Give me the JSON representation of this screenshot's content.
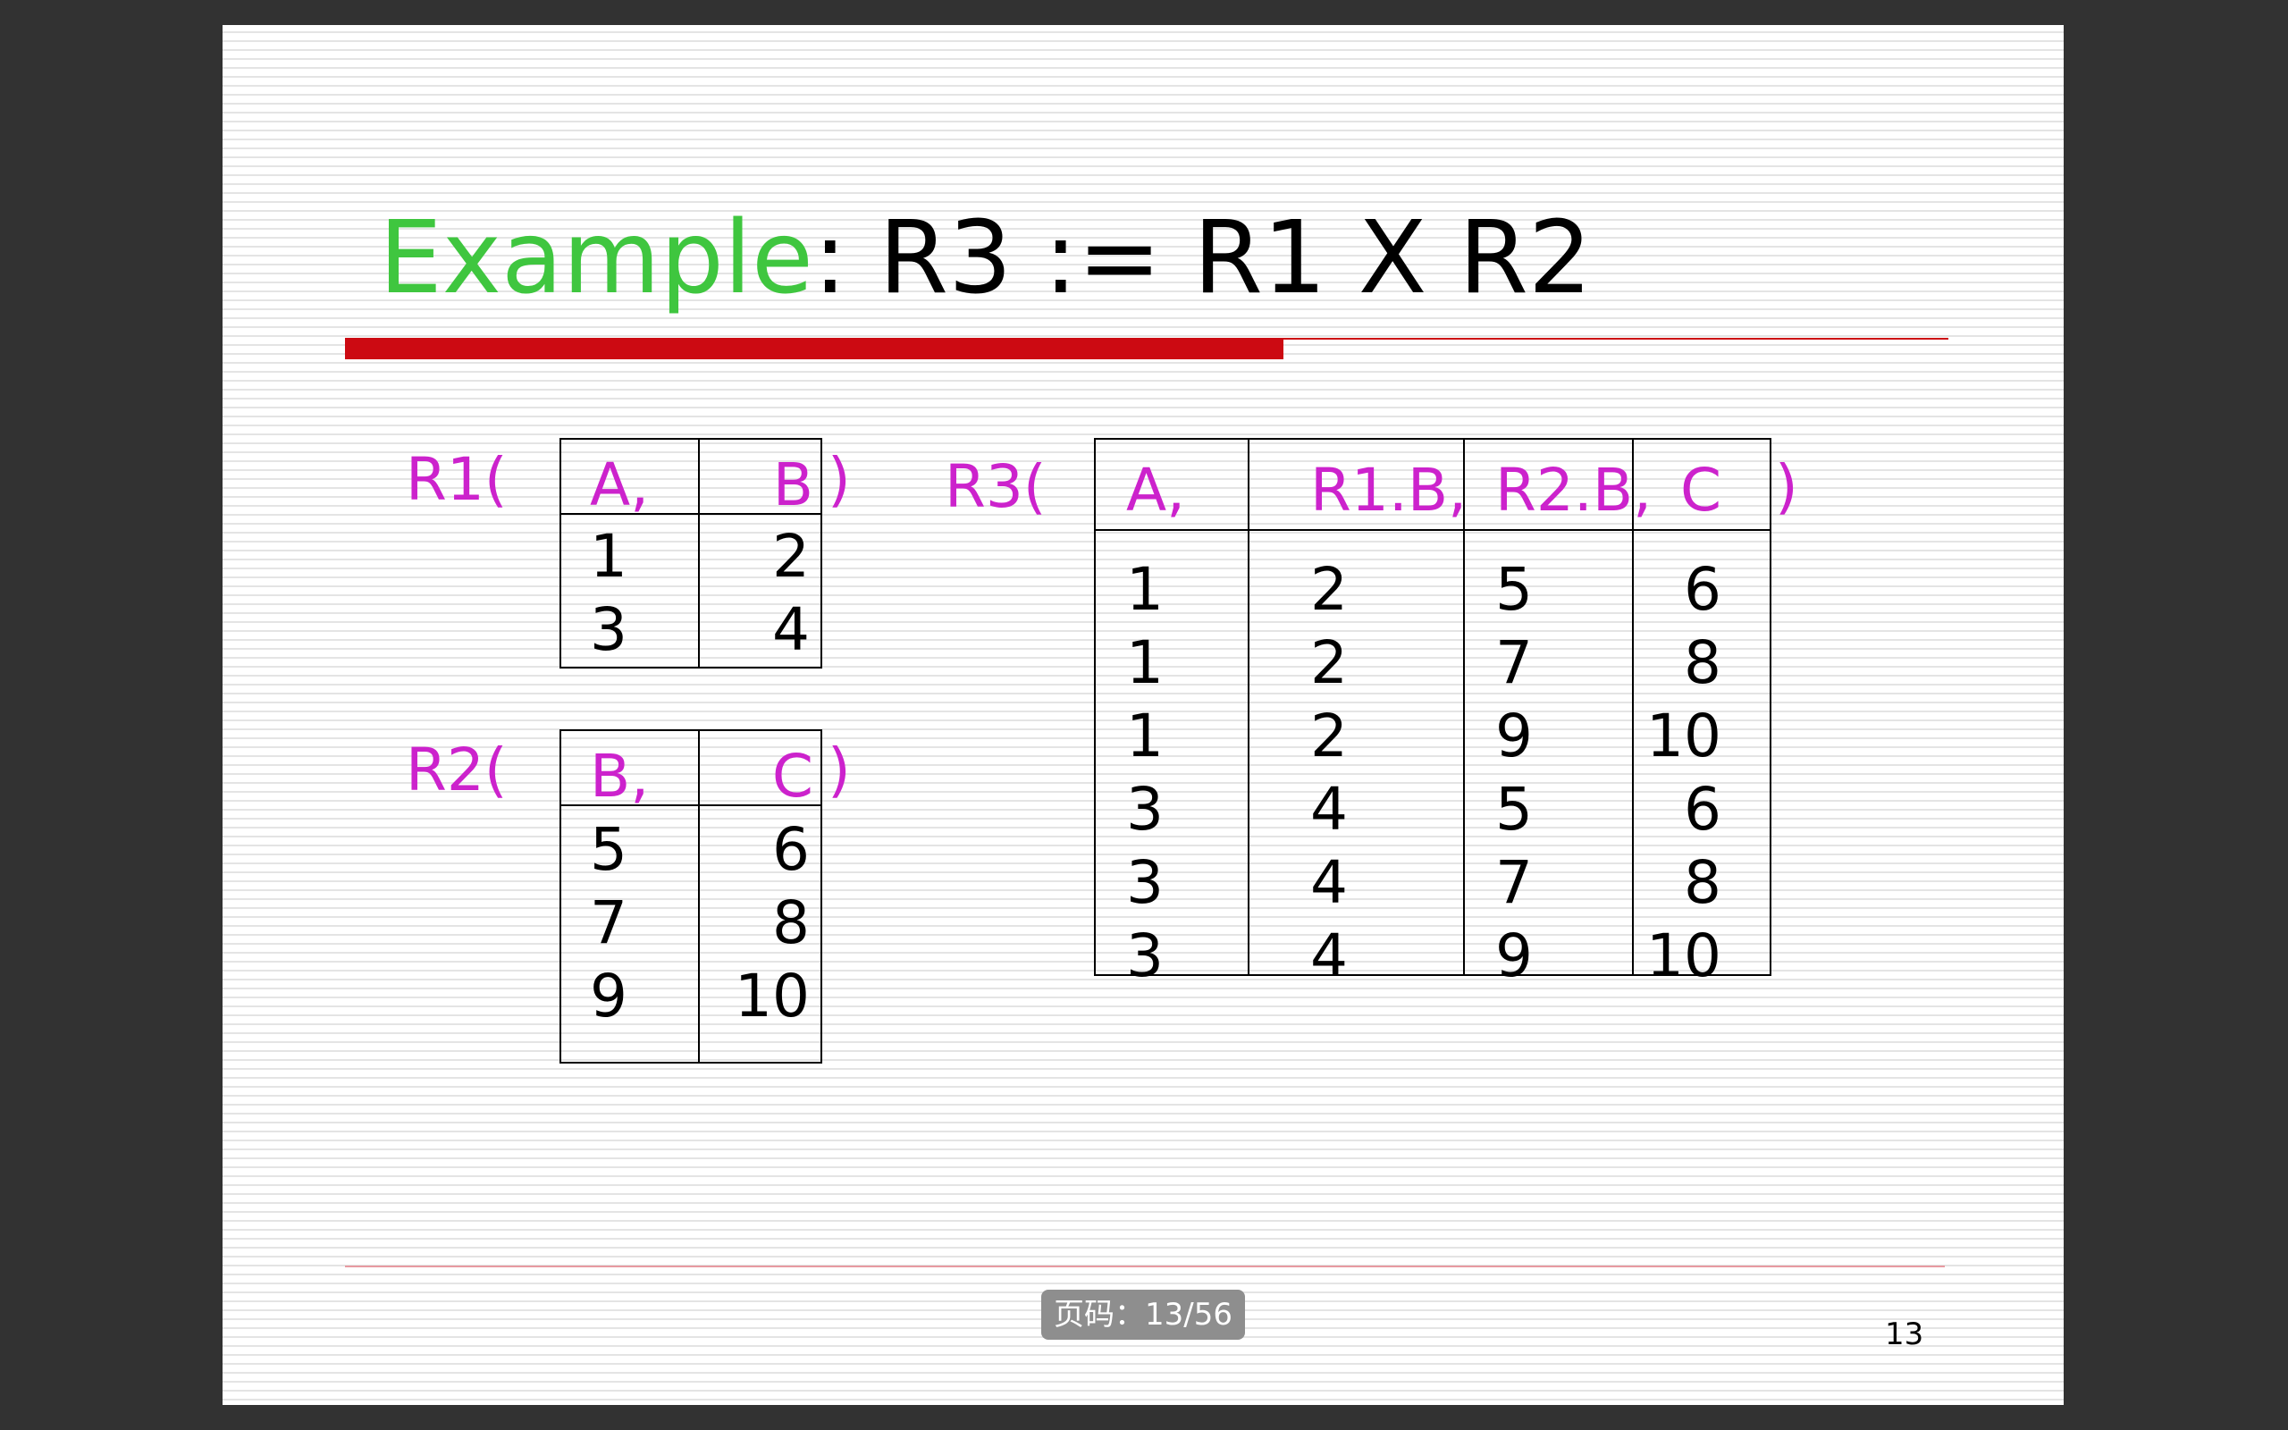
{
  "slide": {
    "title_accent": "Example",
    "title_rest": ": R3 := R1 X R2",
    "page_indicator": "页码：13/56",
    "slide_number": "13"
  },
  "relations": {
    "r1": {
      "open": "R1(",
      "close": ")",
      "headers": [
        "A,",
        "B"
      ],
      "rows": [
        [
          "1",
          "2"
        ],
        [
          "3",
          "4"
        ]
      ]
    },
    "r2": {
      "open": "R2(",
      "close": ")",
      "headers": [
        "B,",
        "C"
      ],
      "rows": [
        [
          "5",
          "6"
        ],
        [
          "7",
          "8"
        ],
        [
          "9",
          "10"
        ]
      ]
    },
    "r3": {
      "open": "R3(",
      "close": ")",
      "headers": [
        "A,",
        "R1.B,",
        "R2.B,",
        "C"
      ],
      "rows": [
        [
          "1",
          "2",
          "5",
          "6"
        ],
        [
          "1",
          "2",
          "7",
          "8"
        ],
        [
          "1",
          "2",
          "9",
          "10"
        ],
        [
          "3",
          "4",
          "5",
          "6"
        ],
        [
          "3",
          "4",
          "7",
          "8"
        ],
        [
          "3",
          "4",
          "9",
          "10"
        ]
      ]
    }
  },
  "colors": {
    "title_accent": "#3fc63f",
    "header_text": "#cc22cc",
    "title_rule": "#cc0a12",
    "footer_rule": "#e79aa1",
    "viewer_background": "#323232"
  }
}
